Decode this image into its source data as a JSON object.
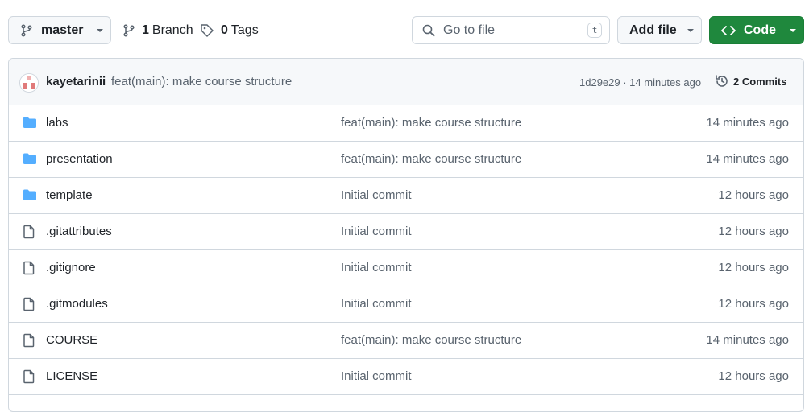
{
  "toolbar": {
    "branch_label": "master",
    "branches_count": "1",
    "branches_label": "Branch",
    "tags_count": "0",
    "tags_label": "Tags",
    "search_placeholder": "Go to file",
    "search_shortcut": "t",
    "add_file_label": "Add file",
    "code_label": "Code"
  },
  "latest_commit": {
    "author": "kayetarinii",
    "message": "feat(main): make course structure",
    "sha_time": "1d29e29 · 14 minutes ago",
    "commits_count": "2 Commits"
  },
  "files": [
    {
      "name": "labs",
      "type": "folder",
      "message": "feat(main): make course structure",
      "age": "14 minutes ago"
    },
    {
      "name": "presentation",
      "type": "folder",
      "message": "feat(main): make course structure",
      "age": "14 minutes ago"
    },
    {
      "name": "template",
      "type": "folder",
      "message": "Initial commit",
      "age": "12 hours ago"
    },
    {
      "name": ".gitattributes",
      "type": "file",
      "message": "Initial commit",
      "age": "12 hours ago"
    },
    {
      "name": ".gitignore",
      "type": "file",
      "message": "Initial commit",
      "age": "12 hours ago"
    },
    {
      "name": ".gitmodules",
      "type": "file",
      "message": "Initial commit",
      "age": "12 hours ago"
    },
    {
      "name": "COURSE",
      "type": "file",
      "message": "feat(main): make course structure",
      "age": "14 minutes ago"
    },
    {
      "name": "LICENSE",
      "type": "file",
      "message": "Initial commit",
      "age": "12 hours ago"
    }
  ],
  "colors": {
    "primary_button": "#1f883d",
    "folder_icon": "#54aeff",
    "muted_text": "#59636e",
    "border": "#d0d7de"
  },
  "icons": [
    "git-branch-icon",
    "tag-icon",
    "search-icon",
    "code-icon",
    "history-icon",
    "folder-icon",
    "file-icon",
    "chevron-down-icon"
  ]
}
